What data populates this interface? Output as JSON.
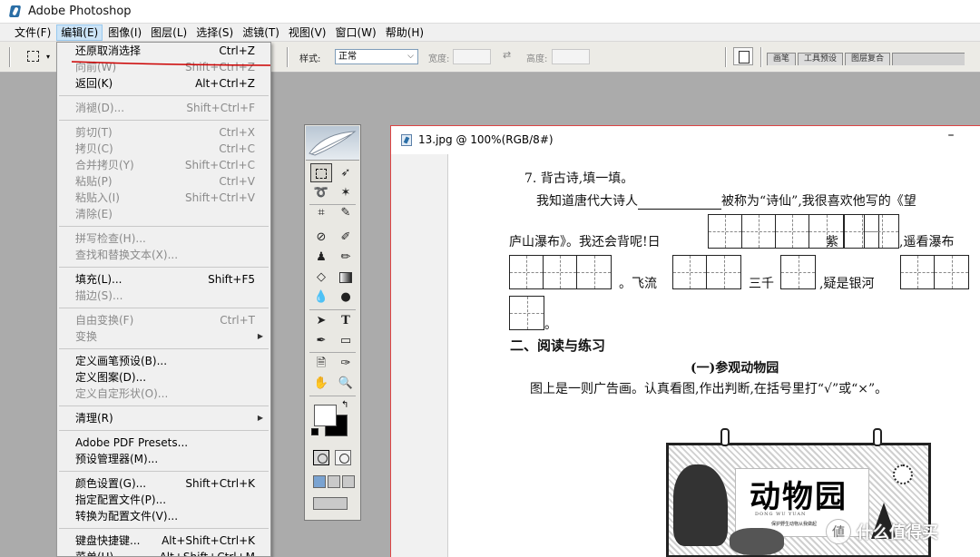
{
  "app": {
    "title": "Adobe Photoshop"
  },
  "menubar": [
    {
      "label": "文件(F)"
    },
    {
      "label": "编辑(E)",
      "active": true
    },
    {
      "label": "图像(I)"
    },
    {
      "label": "图层(L)"
    },
    {
      "label": "选择(S)"
    },
    {
      "label": "滤镜(T)"
    },
    {
      "label": "视图(V)"
    },
    {
      "label": "窗口(W)"
    },
    {
      "label": "帮助(H)"
    }
  ],
  "options_bar": {
    "style_label": "样式:",
    "style_value": "正常",
    "width_label": "宽度:",
    "height_label": "高度:",
    "palette_tabs": [
      "画笔",
      "工具预设",
      "图层复合"
    ]
  },
  "edit_menu": {
    "groups": [
      [
        {
          "label": "还原取消选择",
          "shortcut": "Ctrl+Z",
          "disabled": false
        },
        {
          "label": "向前(W)",
          "shortcut": "Shift+Ctrl+Z",
          "disabled": true
        },
        {
          "label": "返回(K)",
          "shortcut": "Alt+Ctrl+Z",
          "disabled": false
        }
      ],
      [
        {
          "label": "消褪(D)...",
          "shortcut": "Shift+Ctrl+F",
          "disabled": true
        }
      ],
      [
        {
          "label": "剪切(T)",
          "shortcut": "Ctrl+X",
          "disabled": true
        },
        {
          "label": "拷贝(C)",
          "shortcut": "Ctrl+C",
          "disabled": true
        },
        {
          "label": "合并拷贝(Y)",
          "shortcut": "Shift+Ctrl+C",
          "disabled": true
        },
        {
          "label": "粘贴(P)",
          "shortcut": "Ctrl+V",
          "disabled": true
        },
        {
          "label": "粘贴入(I)",
          "shortcut": "Shift+Ctrl+V",
          "disabled": true
        },
        {
          "label": "清除(E)",
          "shortcut": "",
          "disabled": true
        }
      ],
      [
        {
          "label": "拼写检查(H)...",
          "shortcut": "",
          "disabled": true
        },
        {
          "label": "查找和替换文本(X)...",
          "shortcut": "",
          "disabled": true
        }
      ],
      [
        {
          "label": "填充(L)...",
          "shortcut": "Shift+F5",
          "disabled": false
        },
        {
          "label": "描边(S)...",
          "shortcut": "",
          "disabled": true
        }
      ],
      [
        {
          "label": "自由变换(F)",
          "shortcut": "Ctrl+T",
          "disabled": true
        },
        {
          "label": "变换",
          "shortcut": "",
          "disabled": true,
          "submenu": true
        }
      ],
      [
        {
          "label": "定义画笔预设(B)...",
          "shortcut": "",
          "disabled": false
        },
        {
          "label": "定义图案(D)...",
          "shortcut": "",
          "disabled": false
        },
        {
          "label": "定义自定形状(O)...",
          "shortcut": "",
          "disabled": true
        }
      ],
      [
        {
          "label": "清理(R)",
          "shortcut": "",
          "disabled": false,
          "submenu": true
        }
      ],
      [
        {
          "label": "Adobe PDF Presets...",
          "shortcut": "",
          "disabled": false
        },
        {
          "label": "预设管理器(M)...",
          "shortcut": "",
          "disabled": false
        }
      ],
      [
        {
          "label": "颜色设置(G)...",
          "shortcut": "Shift+Ctrl+K",
          "disabled": false
        },
        {
          "label": "指定配置文件(P)...",
          "shortcut": "",
          "disabled": false
        },
        {
          "label": "转换为配置文件(V)...",
          "shortcut": "",
          "disabled": false
        }
      ],
      [
        {
          "label": "键盘快捷键...",
          "shortcut": "Alt+Shift+Ctrl+K",
          "disabled": false
        },
        {
          "label": "菜单(U)",
          "shortcut": "Alt+Shift+Ctrl+M",
          "disabled": false
        }
      ]
    ]
  },
  "document": {
    "title": "13.jpg @ 100%(RGB/8#)",
    "minimize": "–",
    "q7": {
      "heading": "7. 背古诗,填一填。",
      "line1_a": "我知道唐代大诗人",
      "line1_b": "被称为“诗仙”,我很喜欢他写的《望",
      "line2_a": "庐山瀑布》。我还会背呢!日",
      "line2_b": "紫",
      "line2_c": ",遥看瀑布",
      "line3_a": "。飞流",
      "line3_b": "三千",
      "line3_c": ",疑是银河",
      "line4_a": "。"
    },
    "section2": "二、阅读与练习",
    "sub1": "(一)参观动物园",
    "instruction": "图上是一则广告画。认真看图,作出判断,在括号里打“√”或“×”。",
    "ad": {
      "title": "动物园",
      "pinyin": "DONG WU YUAN",
      "slogan": "保护野生动物从我做起"
    }
  },
  "watermark": {
    "text": "什么值得买"
  },
  "colors": {
    "accent": "#cc0000",
    "menu_highlight": "#cce4f7",
    "workspace": "#ababab"
  }
}
